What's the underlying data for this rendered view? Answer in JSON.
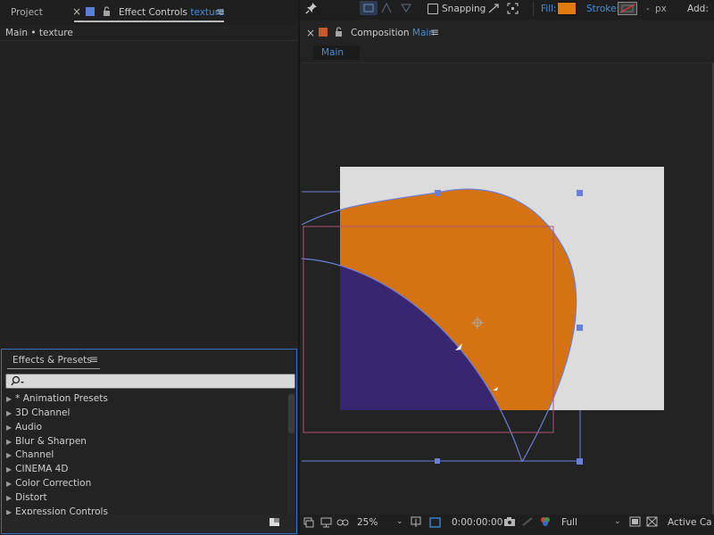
{
  "left_tabs": {
    "project": "Project",
    "close": "×",
    "effect_controls": "Effect Controls",
    "effect_target": "texture",
    "menu": "≡"
  },
  "left_breadcrumb": "Main • texture",
  "toolbar": {
    "snapping_label": "Snapping",
    "fill_label": "Fill:",
    "fill_color": "#e07b12",
    "stroke_label": "Stroke:",
    "stroke_width": "-",
    "stroke_unit": "px",
    "add_label": "Add:"
  },
  "composition_panel": {
    "close": "×",
    "title": "Composition",
    "comp_name": "Main",
    "menu": "≡",
    "flow_tab": "Main"
  },
  "effects_panel": {
    "title": "Effects & Presets",
    "menu": "≡",
    "search_placeholder": "",
    "items": [
      "* Animation Presets",
      "3D Channel",
      "Audio",
      "Blur & Sharpen",
      "Channel",
      "CINEMA 4D",
      "Color Correction",
      "Distort",
      "Expression Controls"
    ]
  },
  "viewer_footer": {
    "zoom": "25%",
    "timecode": "0:00:00:00",
    "resolution": "Full",
    "camera": "Active Ca"
  },
  "colors": {
    "shape_orange": "#d57313",
    "shape_purple": "#392673",
    "comp_bg": "#dcdcdc",
    "accent": "#3f8fe0"
  }
}
